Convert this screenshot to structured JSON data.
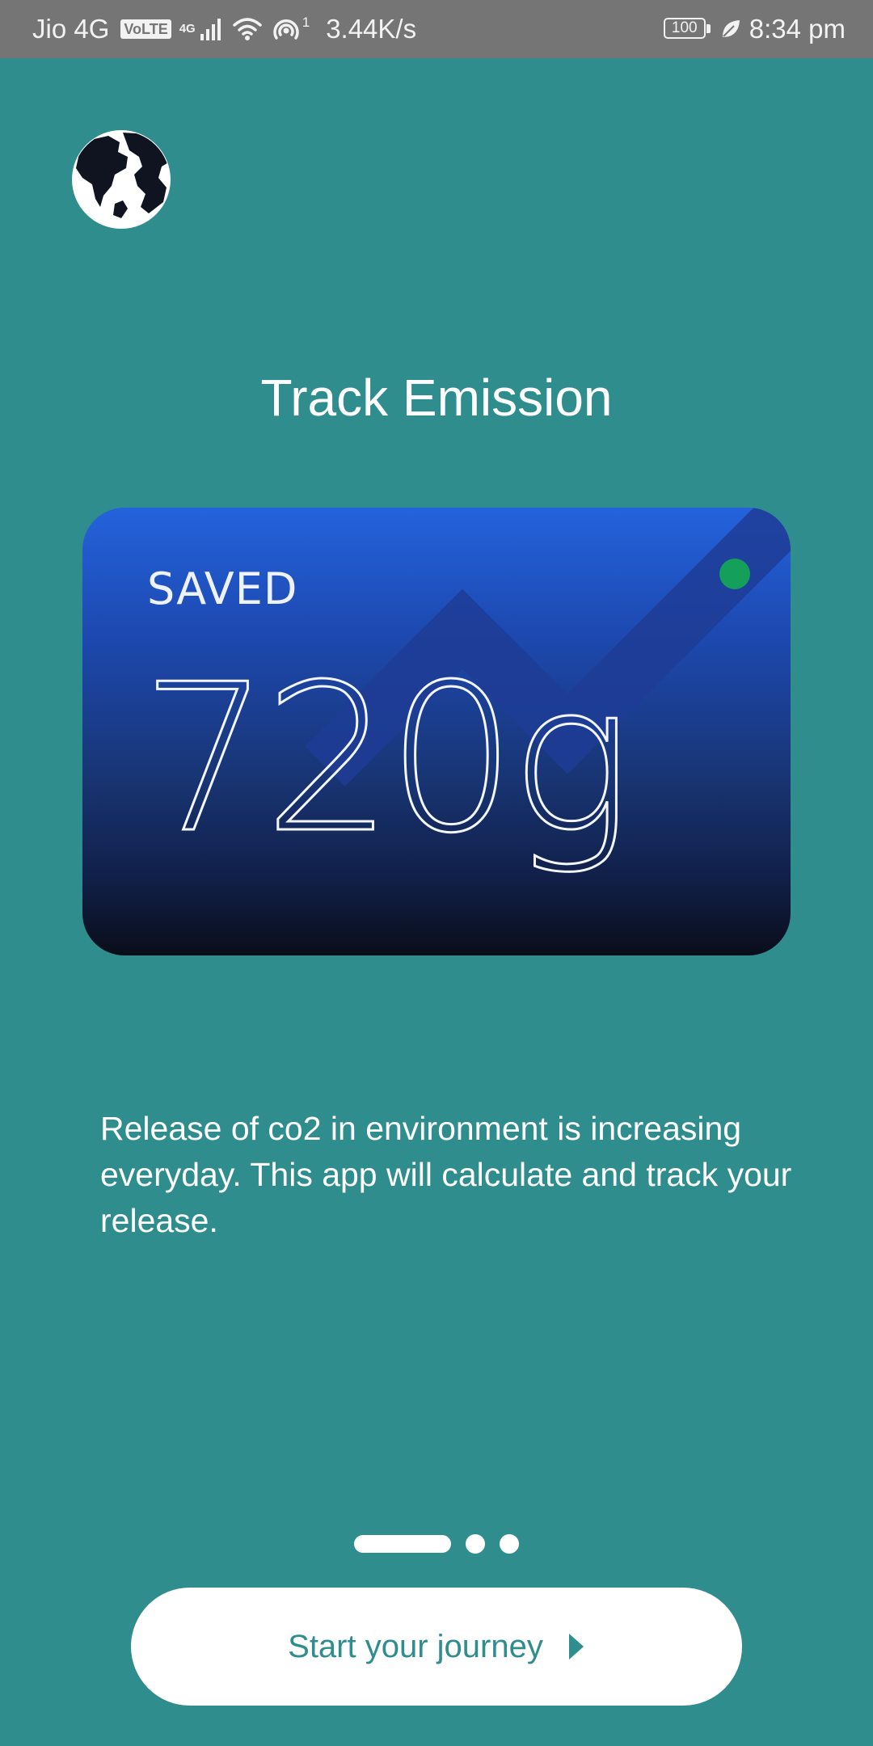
{
  "status_bar": {
    "carrier": "Jio 4G",
    "volte": "VoLTE",
    "network_type": "4G",
    "hotspot_count": "1",
    "speed": "3.44K/s",
    "battery": "100",
    "time": "8:34 pm"
  },
  "logo": {
    "icon": "globe-icon"
  },
  "onboarding": {
    "title": "Track Emission",
    "card": {
      "label": "SAVED",
      "value": "720g",
      "dot_color": "#14a05a"
    },
    "description": "Release of co2 in environment is increasing everyday. This app will calculate and track your release."
  },
  "pager": {
    "pages": 3,
    "active": 1
  },
  "cta": {
    "label": "Start your journey",
    "icon": "play-arrow-icon"
  },
  "colors": {
    "background": "#2f8d8e",
    "card_top": "#2463dc",
    "card_bottom": "#0a0e1a",
    "button_bg": "#ffffff",
    "button_text": "#2f8d8e"
  }
}
